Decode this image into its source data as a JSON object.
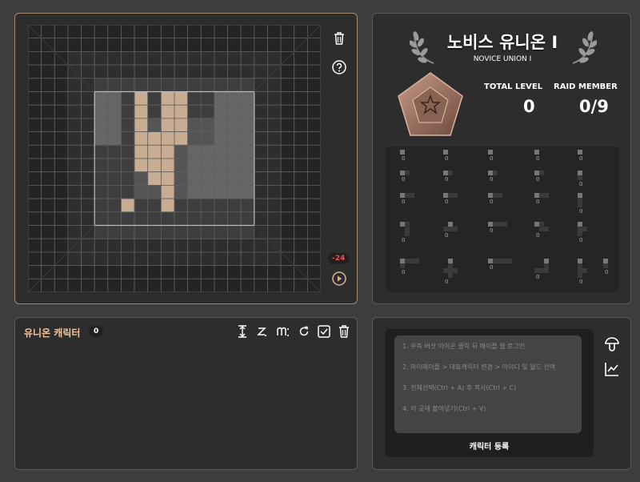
{
  "board": {
    "score": "-24"
  },
  "union": {
    "title": "노비스 유니온 I",
    "subtitle": "NOVICE UNION I",
    "total_level_label": "TOTAL LEVEL",
    "total_level_value": "0",
    "raid_member_label": "RAID MEMBER",
    "raid_member_value": "0/9",
    "class_counts": [
      "0",
      "0",
      "0",
      "0",
      "0",
      "0",
      "0",
      "0",
      "0",
      "0",
      "0",
      "0",
      "0",
      "0",
      "0",
      "0",
      "0",
      "0",
      "0",
      "0",
      "0",
      "0",
      "0",
      "0",
      "0",
      "0"
    ]
  },
  "characters": {
    "title": "유니온 캐릭터",
    "count": "0"
  },
  "input": {
    "hints": [
      "1. 우측 버섯 아이콘 클릭 뒤 메이플 웹 로그인",
      "2. 마이메이플 > 대표캐릭터 변경 > 아이디 및 월드 선택",
      "3. 전체선택(Ctrl + A) 후 복사(Ctrl + C)",
      "4. 이 곳에 붙여넣기(Ctrl + V)"
    ],
    "register_label": "캐릭터 등록"
  },
  "colors": {
    "accent": "#c4a88a",
    "panel": "#2d2d2d",
    "score_red": "#ff4a4a"
  }
}
